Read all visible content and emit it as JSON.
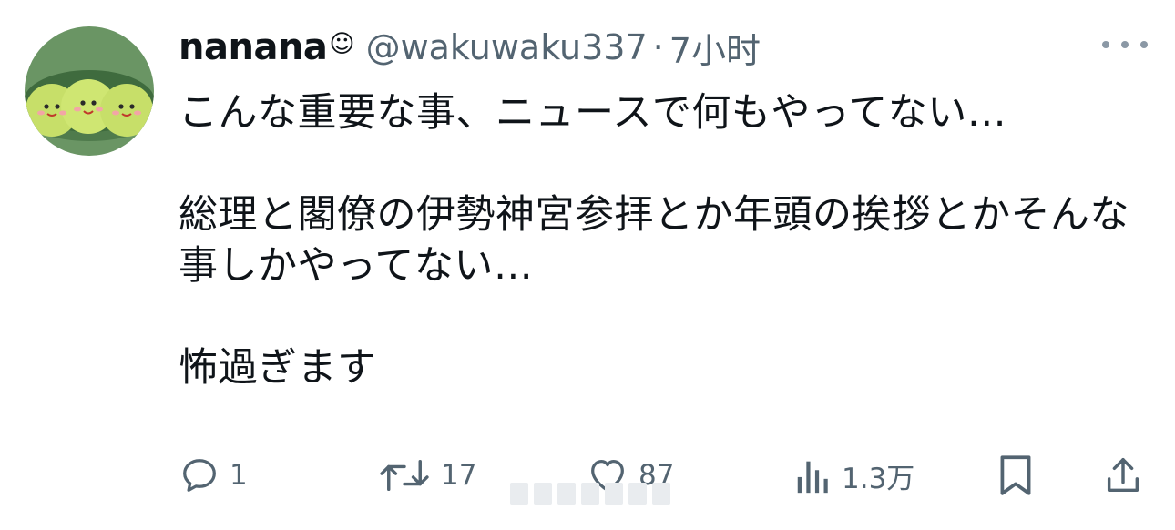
{
  "tweet": {
    "display_name": "nanana",
    "name_emoji": "☺",
    "handle": "@wakuwaku337",
    "separator": "·",
    "time": "7小时",
    "text": "こんな重要な事、ニュースで何もやってない…\n\n総理と閣僚の伊勢神宮参拝とか年頭の挨拶とかそんな事しかやってない…\n\n怖過ぎます"
  },
  "actions": {
    "reply_count": "1",
    "retweet_count": "17",
    "like_count": "87",
    "views_count": "1.3万"
  },
  "icons": {
    "more": "more-dots-icon",
    "reply": "reply-bubble-icon",
    "retweet": "retweet-arrows-icon",
    "like": "heart-icon",
    "views": "views-bars-icon",
    "bookmark": "bookmark-icon",
    "share": "share-icon"
  },
  "colors": {
    "text": "#0f1419",
    "secondary": "#536471",
    "avatar_bg": "#5e8a5a",
    "pea": "#c9e06a"
  }
}
